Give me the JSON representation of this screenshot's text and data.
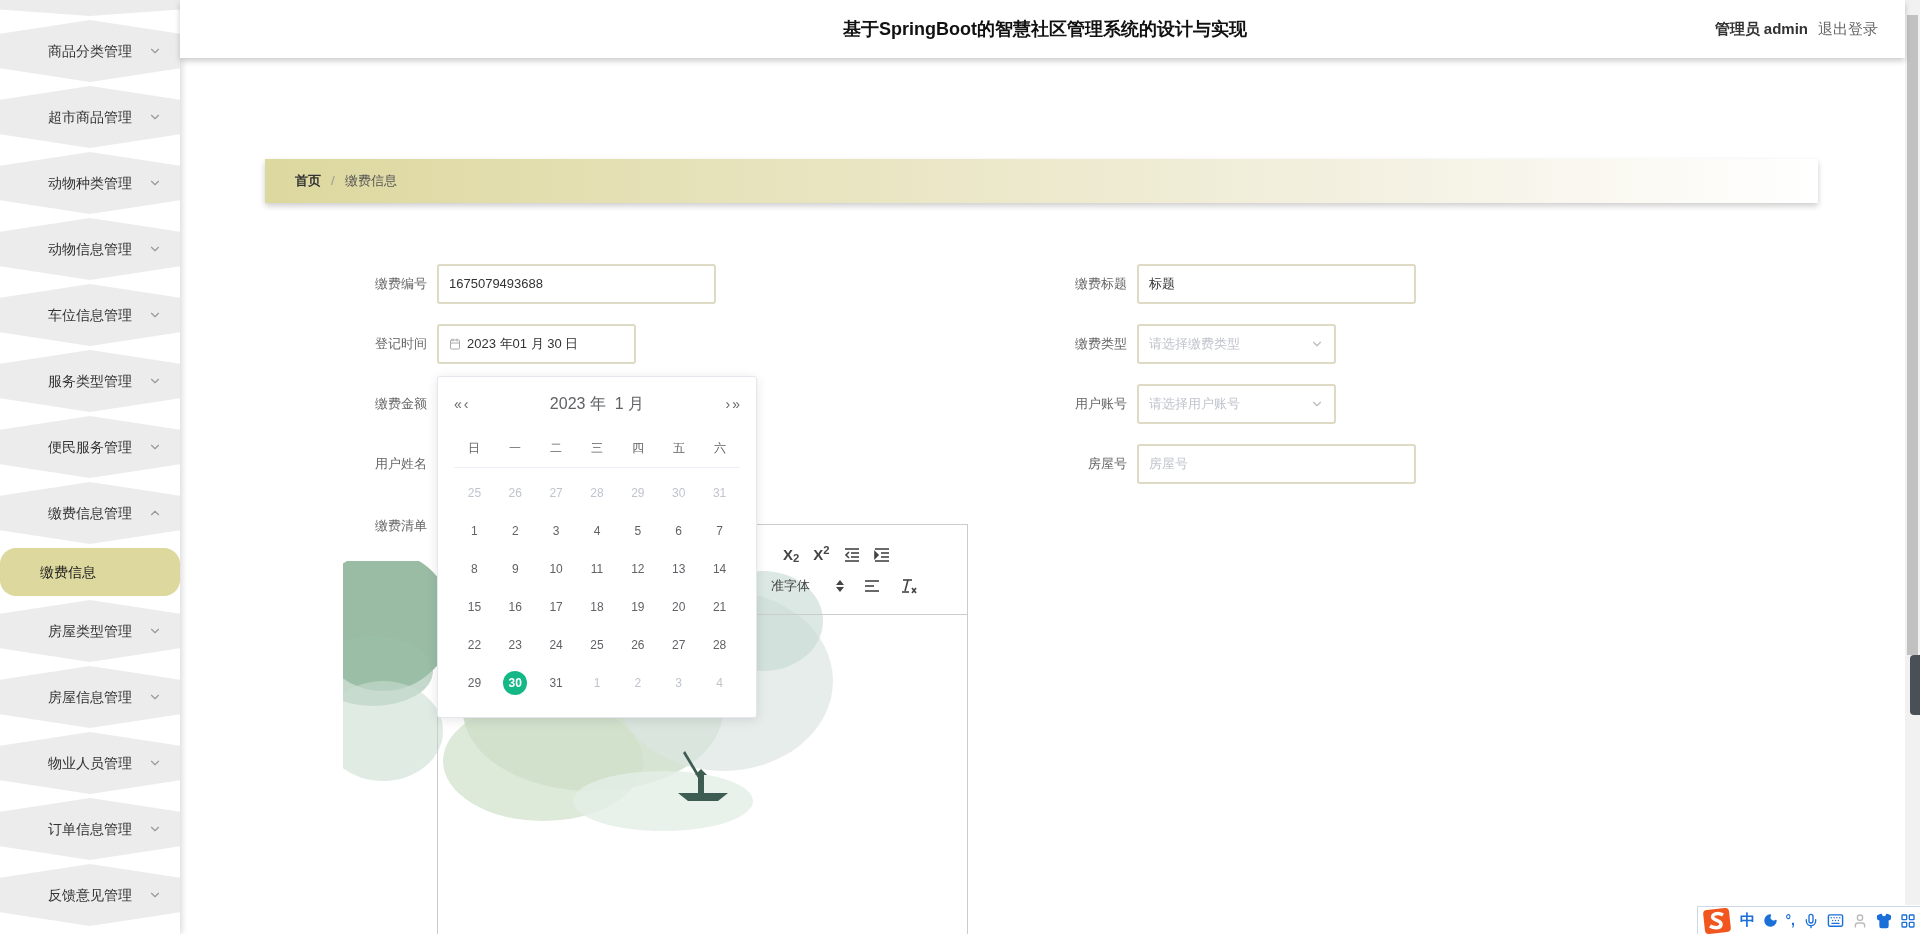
{
  "header": {
    "title": "基于SpringBoot的智慧社区管理系统的设计与实现",
    "role": "管理员",
    "user": "admin",
    "logout": "退出登录"
  },
  "sidebar": {
    "items": [
      {
        "label": "商品分类管理",
        "expanded": false
      },
      {
        "label": "超市商品管理",
        "expanded": false
      },
      {
        "label": "动物种类管理",
        "expanded": false
      },
      {
        "label": "动物信息管理",
        "expanded": false
      },
      {
        "label": "车位信息管理",
        "expanded": false
      },
      {
        "label": "服务类型管理",
        "expanded": false
      },
      {
        "label": "便民服务管理",
        "expanded": false
      },
      {
        "label": "缴费信息管理",
        "expanded": true,
        "children": [
          {
            "label": "缴费信息",
            "selected": true
          }
        ]
      },
      {
        "label": "房屋类型管理",
        "expanded": false
      },
      {
        "label": "房屋信息管理",
        "expanded": false
      },
      {
        "label": "物业人员管理",
        "expanded": false
      },
      {
        "label": "订单信息管理",
        "expanded": false
      },
      {
        "label": "反馈意见管理",
        "expanded": false
      }
    ]
  },
  "breadcrumb": {
    "separator": "/",
    "items": [
      "首页",
      "缴费信息"
    ]
  },
  "form": {
    "left": [
      {
        "label": "缴费编号",
        "kind": "text",
        "value": "1675079493688"
      },
      {
        "label": "登记时间",
        "kind": "date",
        "value": "2023 年01 月 30 日"
      },
      {
        "label": "缴费金额",
        "kind": "covered"
      },
      {
        "label": "用户姓名",
        "kind": "covered"
      },
      {
        "label": "缴费清单",
        "kind": "editor"
      }
    ],
    "right": [
      {
        "label": "缴费标题",
        "kind": "text",
        "value": "标题"
      },
      {
        "label": "缴费类型",
        "kind": "select",
        "placeholder": "请选择缴费类型"
      },
      {
        "label": "用户账号",
        "kind": "select",
        "placeholder": "请选择用户账号"
      },
      {
        "label": "房屋号",
        "kind": "text",
        "placeholder": "房屋号"
      }
    ]
  },
  "editor": {
    "row_1": [
      {
        "kind": "script",
        "text": "X$_{2}$"
      },
      {
        "kind": "script",
        "text": "X$^{2}$"
      },
      {
        "kind": "outdent"
      },
      {
        "kind": "indent"
      }
    ],
    "font": "准字体",
    "row_2": [
      {
        "kind": "align"
      },
      {
        "kind": "clean"
      }
    ]
  },
  "calendar": {
    "prev_year": "«",
    "prev_month": "‹",
    "title": "2023 年  1 月",
    "next_month": "›",
    "next_year": "»",
    "weekdays": [
      "日",
      "一",
      "二",
      "三",
      "四",
      "五",
      "六"
    ],
    "days": [
      {
        "label": "25",
        "outside": true,
        "selected": false
      },
      {
        "label": "26",
        "outside": true,
        "selected": false
      },
      {
        "label": "27",
        "outside": true,
        "selected": false
      },
      {
        "label": "28",
        "outside": true,
        "selected": false
      },
      {
        "label": "29",
        "outside": true,
        "selected": false
      },
      {
        "label": "30",
        "outside": true,
        "selected": false
      },
      {
        "label": "31",
        "outside": true,
        "selected": false
      },
      {
        "label": "1",
        "outside": false,
        "selected": false
      },
      {
        "label": "2",
        "outside": false,
        "selected": false
      },
      {
        "label": "3",
        "outside": false,
        "selected": false
      },
      {
        "label": "4",
        "outside": false,
        "selected": false
      },
      {
        "label": "5",
        "outside": false,
        "selected": false
      },
      {
        "label": "6",
        "outside": false,
        "selected": false
      },
      {
        "label": "7",
        "outside": false,
        "selected": false
      },
      {
        "label": "8",
        "outside": false,
        "selected": false
      },
      {
        "label": "9",
        "outside": false,
        "selected": false
      },
      {
        "label": "10",
        "outside": false,
        "selected": false
      },
      {
        "label": "11",
        "outside": false,
        "selected": false
      },
      {
        "label": "12",
        "outside": false,
        "selected": false
      },
      {
        "label": "13",
        "outside": false,
        "selected": false
      },
      {
        "label": "14",
        "outside": false,
        "selected": false
      },
      {
        "label": "15",
        "outside": false,
        "selected": false
      },
      {
        "label": "16",
        "outside": false,
        "selected": false
      },
      {
        "label": "17",
        "outside": false,
        "selected": false
      },
      {
        "label": "18",
        "outside": false,
        "selected": false
      },
      {
        "label": "19",
        "outside": false,
        "selected": false
      },
      {
        "label": "20",
        "outside": false,
        "selected": false
      },
      {
        "label": "21",
        "outside": false,
        "selected": false
      },
      {
        "label": "22",
        "outside": false,
        "selected": false
      },
      {
        "label": "23",
        "outside": false,
        "selected": false
      },
      {
        "label": "24",
        "outside": false,
        "selected": false
      },
      {
        "label": "25",
        "outside": false,
        "selected": false
      },
      {
        "label": "26",
        "outside": false,
        "selected": false
      },
      {
        "label": "27",
        "outside": false,
        "selected": false
      },
      {
        "label": "28",
        "outside": false,
        "selected": false
      },
      {
        "label": "29",
        "outside": false,
        "selected": false
      },
      {
        "label": "30",
        "outside": false,
        "selected": true
      },
      {
        "label": "31",
        "outside": false,
        "selected": false
      },
      {
        "label": "1",
        "outside": true,
        "selected": false
      },
      {
        "label": "2",
        "outside": true,
        "selected": false
      },
      {
        "label": "3",
        "outside": true,
        "selected": false
      },
      {
        "label": "4",
        "outside": true,
        "selected": false
      }
    ]
  },
  "ime": {
    "mode": "中",
    "punct": "°,"
  }
}
